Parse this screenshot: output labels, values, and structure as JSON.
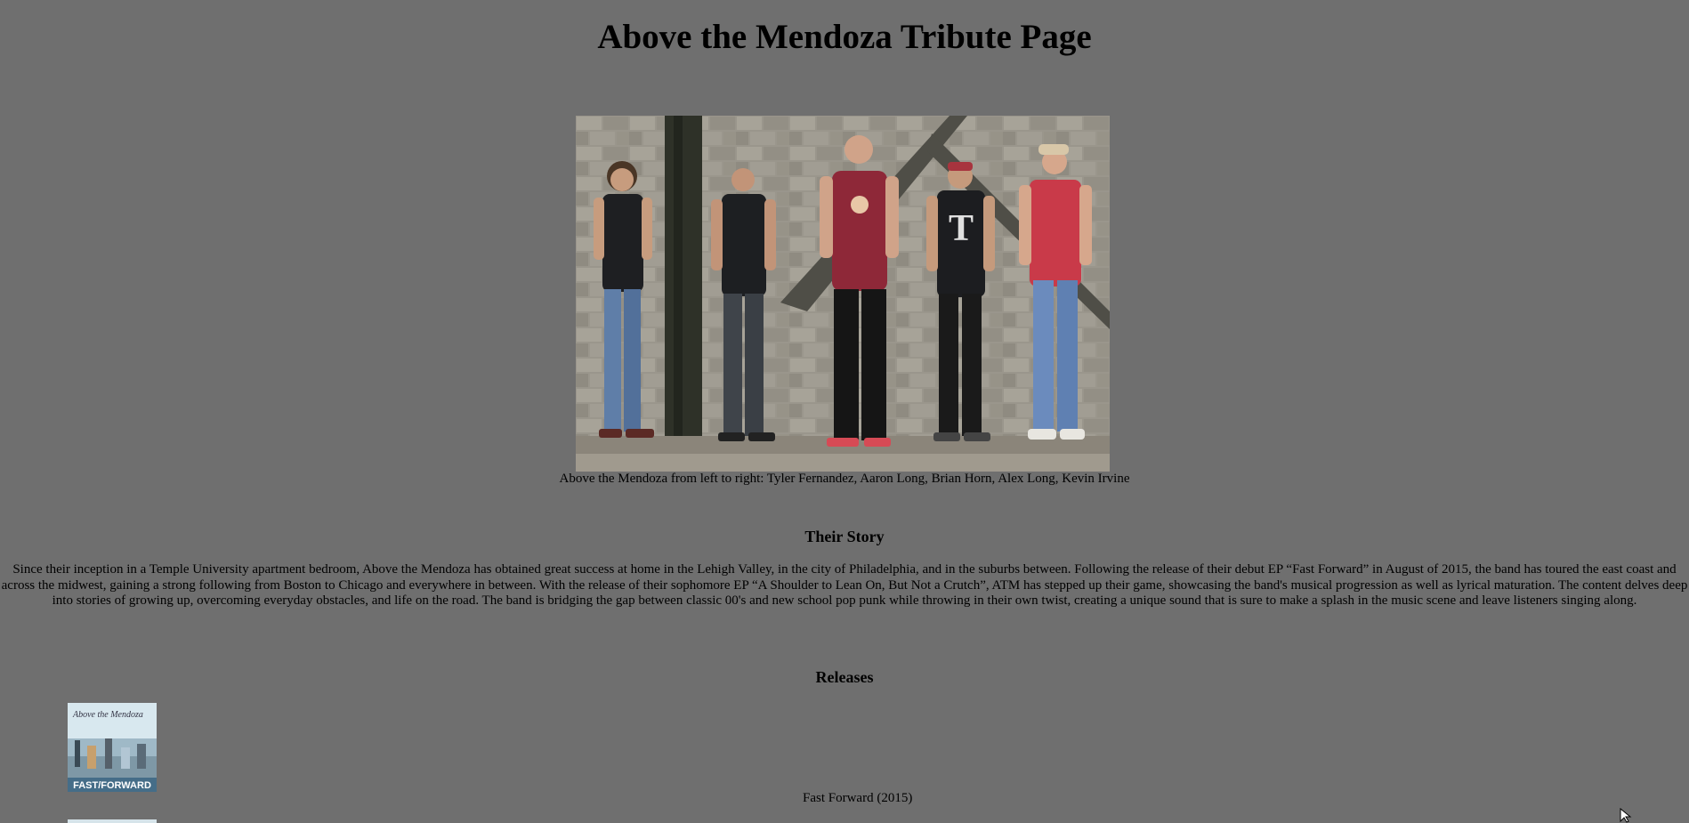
{
  "page": {
    "title": "Above the Mendoza Tribute Page"
  },
  "photo": {
    "caption": "Above the Mendoza from left to right: Tyler Fernandez, Aaron Long, Brian Horn, Alex Long, Kevin Irvine"
  },
  "story": {
    "heading": "Their Story",
    "text": "Since their inception in a Temple University apartment bedroom, Above the Mendoza has obtained great success at home in the Lehigh Valley, in the city of Philadelphia, and in the suburbs between. Following the release of their debut EP “Fast Forward” in August of 2015, the band has toured the east coast and across the midwest, gaining a strong following from Boston to Chicago and everywhere in between. With the release of their sophomore EP “A Shoulder to Lean On, But Not a Crutch”, ATM has stepped up their game, showcasing the band's musical progression as well as lyrical maturation. The content delves deep into stories of growing up, overcoming everyday obstacles, and life on the road. The band is bridging the gap between classic 00's and new school pop punk while throwing in their own twist, creating a unique sound that is sure to make a splash in the music scene and leave listeners singing along."
  },
  "releases": {
    "heading": "Releases",
    "items": [
      {
        "label": "Fast Forward (2015)",
        "cover_text": "FAST/FORWARD",
        "cover_script": "Above the Mendoza"
      }
    ]
  },
  "colors": {
    "background": "#6f6f6f",
    "text": "#000000"
  }
}
